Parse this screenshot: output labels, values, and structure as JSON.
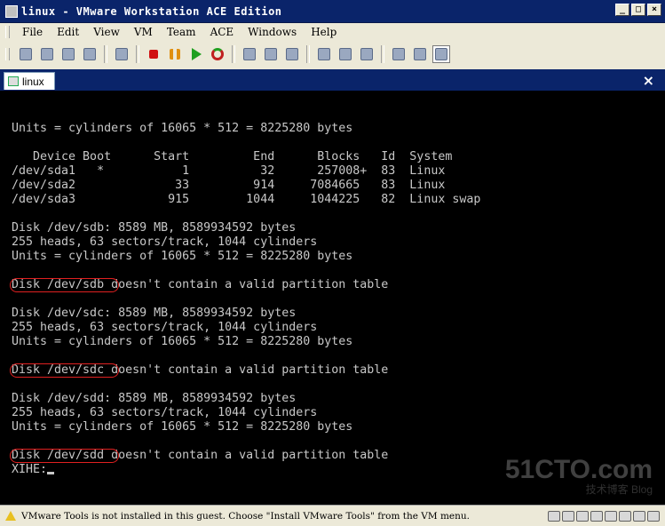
{
  "window": {
    "title": "linux - VMware Workstation ACE Edition",
    "controls": [
      "_",
      "□",
      "×"
    ]
  },
  "menu": [
    "File",
    "Edit",
    "View",
    "VM",
    "Team",
    "ACE",
    "Windows",
    "Help"
  ],
  "toolbar": {
    "groups": [
      [
        "snapshot-icon",
        "revert-icon",
        "take-snapshot-icon",
        "manage-snapshot-icon"
      ],
      [
        "vm-settings-icon"
      ],
      [
        "power-off-icon",
        "suspend-icon",
        "power-on-icon",
        "reset-icon"
      ],
      [
        "team-icon",
        "clone-icon",
        "ace-icon"
      ],
      [
        "view-normal-icon",
        "view-fullscreen-icon",
        "view-quickswitch-icon"
      ],
      [
        "summary-icon",
        "appliance-icon",
        "console-view-icon"
      ]
    ],
    "colors": {
      "power-off-icon": "#d01010",
      "suspend-icon": "#e09010",
      "power-on-icon": "#20a020",
      "reset-icon": "#c02020"
    }
  },
  "tab": {
    "label": "linux",
    "close": "×"
  },
  "console": {
    "lines": [
      "Units = cylinders of 16065 * 512 = 8225280 bytes",
      "",
      "   Device Boot      Start         End      Blocks   Id  System",
      "/dev/sda1   *           1          32      257008+  83  Linux",
      "/dev/sda2              33         914     7084665   83  Linux",
      "/dev/sda3             915        1044     1044225   82  Linux swap",
      "",
      "Disk /dev/sdb: 8589 MB, 8589934592 bytes",
      "255 heads, 63 sectors/track, 1044 cylinders",
      "Units = cylinders of 16065 * 512 = 8225280 bytes",
      "",
      "Disk /dev/sdb doesn't contain a valid partition table",
      "",
      "Disk /dev/sdc: 8589 MB, 8589934592 bytes",
      "255 heads, 63 sectors/track, 1044 cylinders",
      "Units = cylinders of 16065 * 512 = 8225280 bytes",
      "",
      "Disk /dev/sdc doesn't contain a valid partition table",
      "",
      "Disk /dev/sdd: 8589 MB, 8589934592 bytes",
      "255 heads, 63 sectors/track, 1044 cylinders",
      "Units = cylinders of 16065 * 512 = 8225280 bytes",
      "",
      "Disk /dev/sdd doesn't contain a valid partition table"
    ],
    "prompt": "XIHE:",
    "highlighted_lines": [
      11,
      17,
      23
    ],
    "highlight_color": "#e02020"
  },
  "watermark": {
    "main": "51CTO.com",
    "sub": "技术博客  Blog"
  },
  "status": {
    "message": "VMware Tools is not installed in this guest. Choose \"Install VMware Tools\" from the VM menu.",
    "devices": [
      "hdd-icon",
      "cdrom-icon",
      "floppy-icon",
      "network-icon",
      "usb-icon",
      "sound-icon",
      "speaker-icon",
      "message-icon"
    ]
  }
}
